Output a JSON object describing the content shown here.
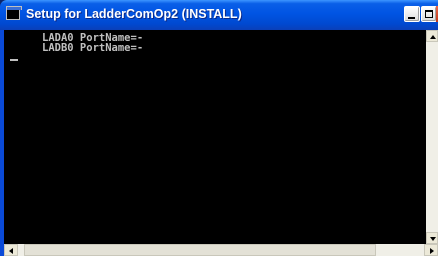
{
  "window": {
    "title": "Setup for LadderComOp2 (INSTALL)",
    "icon": "console-icon",
    "icon_glyph": "C:\\"
  },
  "console": {
    "lines": [
      "LADA0 PortName=-",
      "LADB0 PortName=-"
    ],
    "text_color": "#c0c0c0",
    "background": "#000000"
  },
  "colors": {
    "titlebar": "#0054e3",
    "title_text": "#ffffff"
  }
}
